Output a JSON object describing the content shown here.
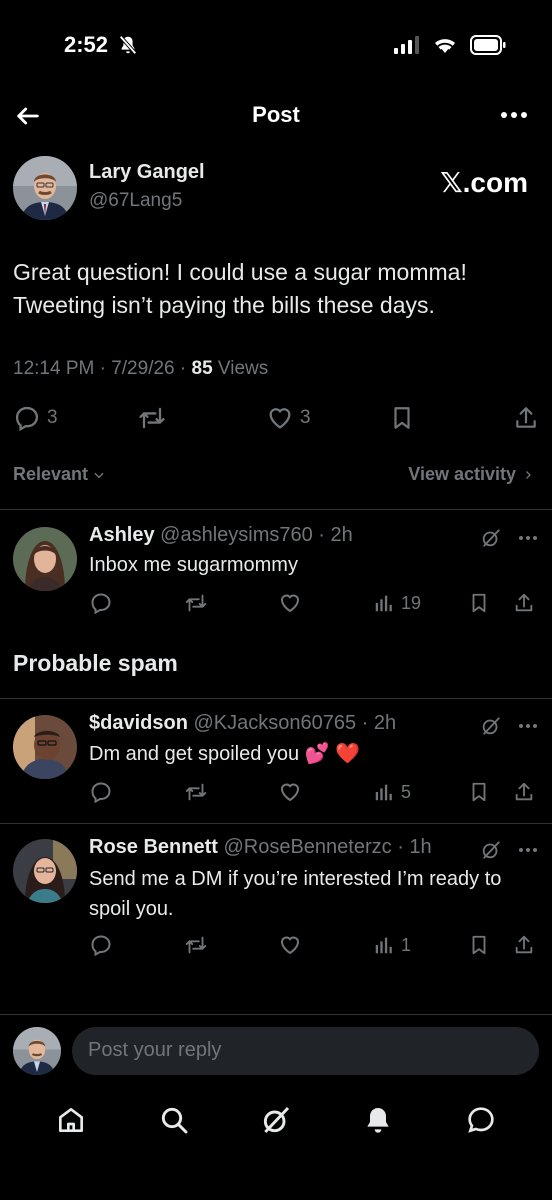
{
  "status_bar": {
    "time": "2:52"
  },
  "header": {
    "title": "Post"
  },
  "post": {
    "author_name": "Lary Gangel",
    "author_handle": "@67Lang5",
    "source": "𝕏.com",
    "text": "Great question! I could use a sugar momma! Tweeting isn’t paying the bills these days.",
    "time": "12:14 PM · 7/29/26 · ",
    "views_count": "85",
    "views_label": " Views",
    "replies": "3",
    "likes": "3"
  },
  "sort": {
    "label": "Relevant",
    "view_activity": "View activity"
  },
  "replies": [
    {
      "name": "Ashley",
      "handle": "@ashleysims760",
      "time": " · 2h",
      "text": "Inbox me sugarmommy",
      "views": "19"
    }
  ],
  "spam_section": {
    "title": "Probable spam"
  },
  "spam_replies": [
    {
      "name": "$davidson",
      "handle": "@KJackson60765",
      "time": " · 2h",
      "text": "Dm and get spoiled you 💕 ❤️",
      "views": "5"
    },
    {
      "name": "Rose Bennett",
      "handle": "@RoseBenneterzc",
      "time": " · 1h",
      "text": "Send me a DM if you’re interested I’m ready to spoil you.",
      "views": "1"
    }
  ],
  "reply_box": {
    "placeholder": "Post your reply"
  },
  "tabs": [
    "home-icon",
    "search-icon",
    "grok-icon",
    "notifications-icon",
    "messages-icon"
  ],
  "colors": {
    "background": "#000000",
    "text": "#e7e9ea",
    "muted": "#71767b",
    "divider": "#2f3336",
    "heart_red": "#f2384c"
  }
}
